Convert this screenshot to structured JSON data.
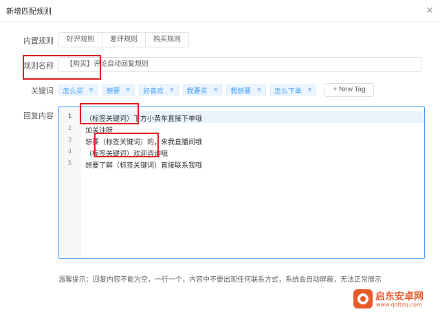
{
  "dialog": {
    "title": "新增匹配规则",
    "close_label": "×"
  },
  "builtin_rules": {
    "label": "内置规则",
    "buttons": [
      "好评规则",
      "差评规则",
      "购买规则"
    ]
  },
  "rule_name": {
    "label": "规则名称",
    "value": "【购买】评论自动回复规则"
  },
  "keywords": {
    "label": "关键词",
    "tags": [
      "怎么买",
      "想要",
      "好喜欢",
      "我要买",
      "我想要",
      "怎么下单"
    ],
    "close_glyph": "×",
    "new_tag_label": "+ New Tag"
  },
  "reply": {
    "label": "回复内容",
    "lines": [
      {
        "num": "1",
        "text": "（标签关键词）下方小黄车直接下单哦"
      },
      {
        "num": "2",
        "text": "加关注呀"
      },
      {
        "num": "3",
        "text": "想要（标签关键词）的，来我直播间哦"
      },
      {
        "num": "4",
        "text": "（标签关键词）欢迎咨询哦"
      },
      {
        "num": "5",
        "text": "想要了解（标签关键词）直接联系我哦"
      }
    ]
  },
  "hint": "温馨提示：回复内容不能为空，一行一个，内容中不要出现任何联系方式，系统会自动屏蔽，无法正常展示",
  "watermark": {
    "title": "启东安卓网",
    "url": "www.qdltdq.com"
  },
  "colors": {
    "accent": "#409eff",
    "highlight_box": "#e02020",
    "watermark": "#e85a2a"
  }
}
